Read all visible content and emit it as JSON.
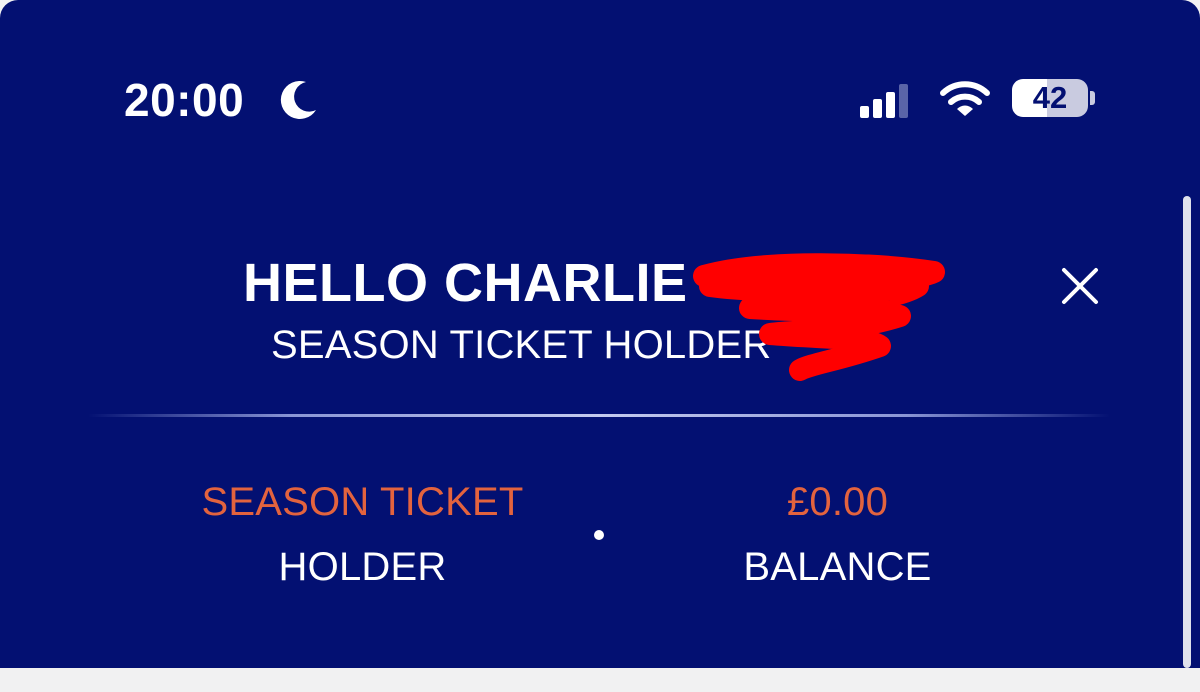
{
  "status_bar": {
    "time": "20:00",
    "battery_level": "42",
    "icons": [
      "moon-icon",
      "signal-icon",
      "wifi-icon",
      "battery-icon"
    ]
  },
  "header": {
    "greeting": "HELLO CHARLIE",
    "subtitle": "SEASON TICKET HOLDER",
    "close_icon": "close-icon"
  },
  "stats": {
    "left": {
      "value": "SEASON TICKET",
      "label": "HOLDER"
    },
    "right": {
      "value": "£0.00",
      "label": "BALANCE"
    }
  },
  "colors": {
    "background": "#031072",
    "accent": "#e3633e",
    "text": "#ffffff",
    "redaction": "#ff0000"
  }
}
